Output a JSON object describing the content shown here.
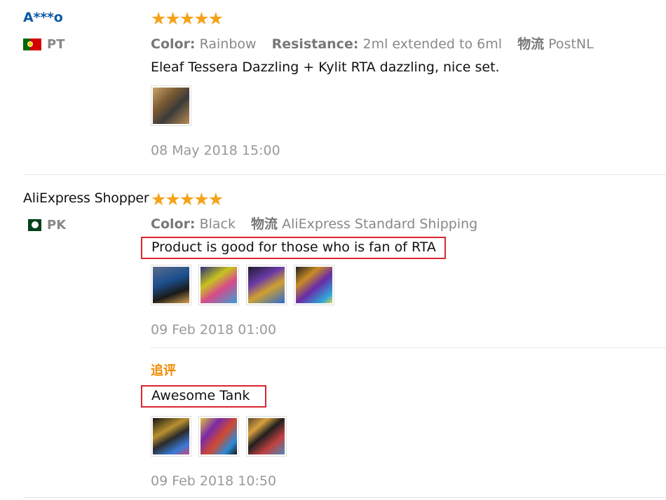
{
  "reviews": [
    {
      "user": "A***o",
      "country": "PT",
      "rating": 5,
      "meta": {
        "color_label": "Color:",
        "color_value": "Rainbow",
        "resistance_label": "Resistance:",
        "resistance_value": "2ml extended to 6ml",
        "shipping_label": "物流",
        "shipping_value": "PostNL"
      },
      "text": "Eleaf Tessera Dazzling + Kylit RTA dazzling, nice set.",
      "date": "08 May 2018 15:00"
    },
    {
      "user": "AliExpress Shopper",
      "country": "PK",
      "rating": 5,
      "meta": {
        "color_label": "Color:",
        "color_value": "Black",
        "shipping_label": "物流",
        "shipping_value": "AliExpress Standard Shipping"
      },
      "text": "Product is good for those who is fan of RTA",
      "date": "09 Feb 2018 01:00",
      "followup": {
        "label": "追评",
        "text": "Awesome Tank",
        "date": "09 Feb 2018 10:50"
      }
    }
  ],
  "star_glyph": "★★★★★",
  "colors": {
    "star": "#f6a21a",
    "username_link": "#0c5aa6",
    "followup_label": "#f08a00",
    "highlight_box": "#d8272d"
  }
}
